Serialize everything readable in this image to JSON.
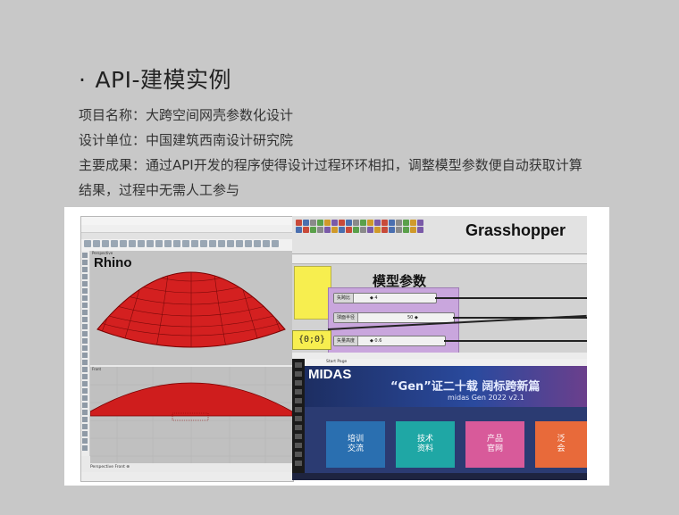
{
  "slide": {
    "title_bullet": "·",
    "title": "API-建模实例",
    "line1": "项目名称：大跨空间网壳参数化设计",
    "line2": "设计单位：中国建筑西南设计研究院",
    "line3": "主要成果：通过API开发的程序使得设计过程环环相扣，调整模型参数便自动获取计算",
    "line4": "结果，过程中无需人工参与"
  },
  "rhino": {
    "label": "Rhino",
    "viewport_top": "Perspective",
    "viewport_front": "Front",
    "bottom_tabs": "Perspective  Front  ⊕"
  },
  "grasshopper": {
    "label": "Grasshopper",
    "group_title": "模型参数",
    "panel_value": "{0;0}",
    "sliders": [
      {
        "label": "矢跨比",
        "value": "◆ 4"
      },
      {
        "label": "球面半径",
        "value": "50 ◆"
      },
      {
        "label": "矢量高度",
        "value": "◆ 0.6"
      }
    ]
  },
  "midas": {
    "label": "MIDAS",
    "tab": "Start Page",
    "slogan": "“Gen”证二十载 阔标跨新篇",
    "version": "midas Gen 2022 v2.1",
    "tiles": [
      {
        "line1": "培训",
        "line2": "交流",
        "color": "#2a6fb0"
      },
      {
        "line1": "技术",
        "line2": "资料",
        "color": "#1fa7a5"
      },
      {
        "line1": "产品",
        "line2": "官网",
        "color": "#d85a9a"
      },
      {
        "line1": "泛",
        "line2": "会",
        "color": "#e86a3a"
      }
    ]
  }
}
